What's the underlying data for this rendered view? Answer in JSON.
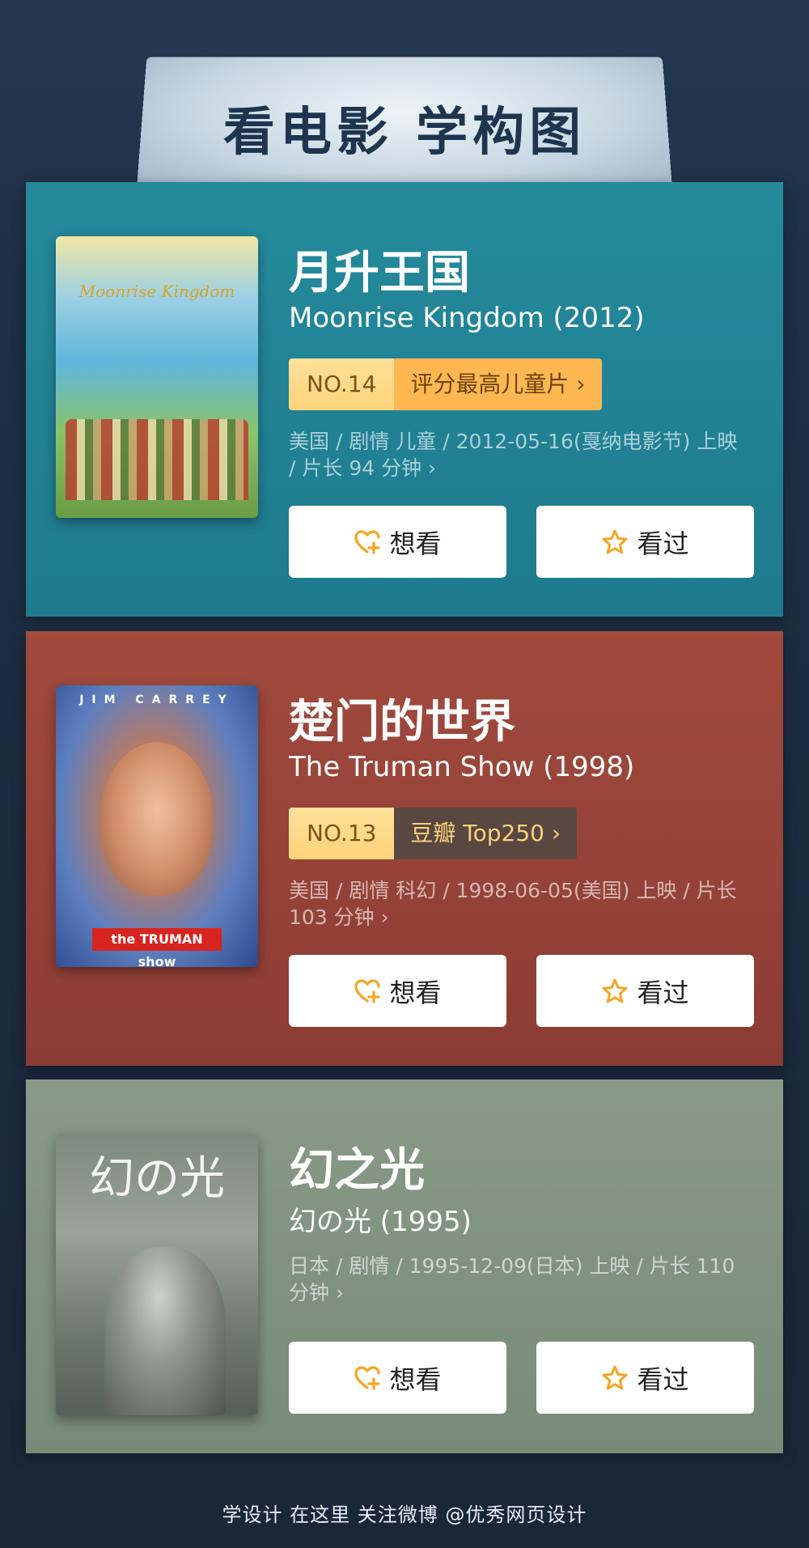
{
  "header": {
    "title": "看电影 学构图"
  },
  "movies": [
    {
      "title_cn": "月升王国",
      "title_en": "Moonrise Kingdom (2012)",
      "rank_no": "NO.14",
      "rank_label": "评分最高儿童片 ›",
      "meta": "美国 / 剧情 儿童 / 2012-05-16(戛纳电影节) 上映 / 片长 94 分钟 ›",
      "poster_text": "Moonrise Kingdom"
    },
    {
      "title_cn": "楚门的世界",
      "title_en": "The Truman Show (1998)",
      "rank_no": "NO.13",
      "rank_label": "豆瓣 Top250 ›",
      "meta": "美国 / 剧情 科幻 / 1998-06-05(美国) 上映 / 片长 103 分钟 ›",
      "poster_text": "JIM CARREY",
      "poster_badge": "the TRUMAN show"
    },
    {
      "title_cn": "幻之光",
      "title_en": "幻の光 (1995)",
      "meta": "日本 / 剧情 / 1995-12-09(日本) 上映 / 片长 110 分钟 ›",
      "poster_text": "幻の光"
    }
  ],
  "buttons": {
    "want_label": "想看",
    "seen_label": "看过"
  },
  "icons": {
    "want": "heart-plus-icon",
    "seen": "star-outline-icon"
  },
  "colors": {
    "accent": "#f5a623",
    "card1": "#1f7a8f",
    "card2": "#8c3c33",
    "card3": "#788a78"
  },
  "footer": {
    "text": "学设计 在这里    关注微博 @优秀网页设计"
  }
}
